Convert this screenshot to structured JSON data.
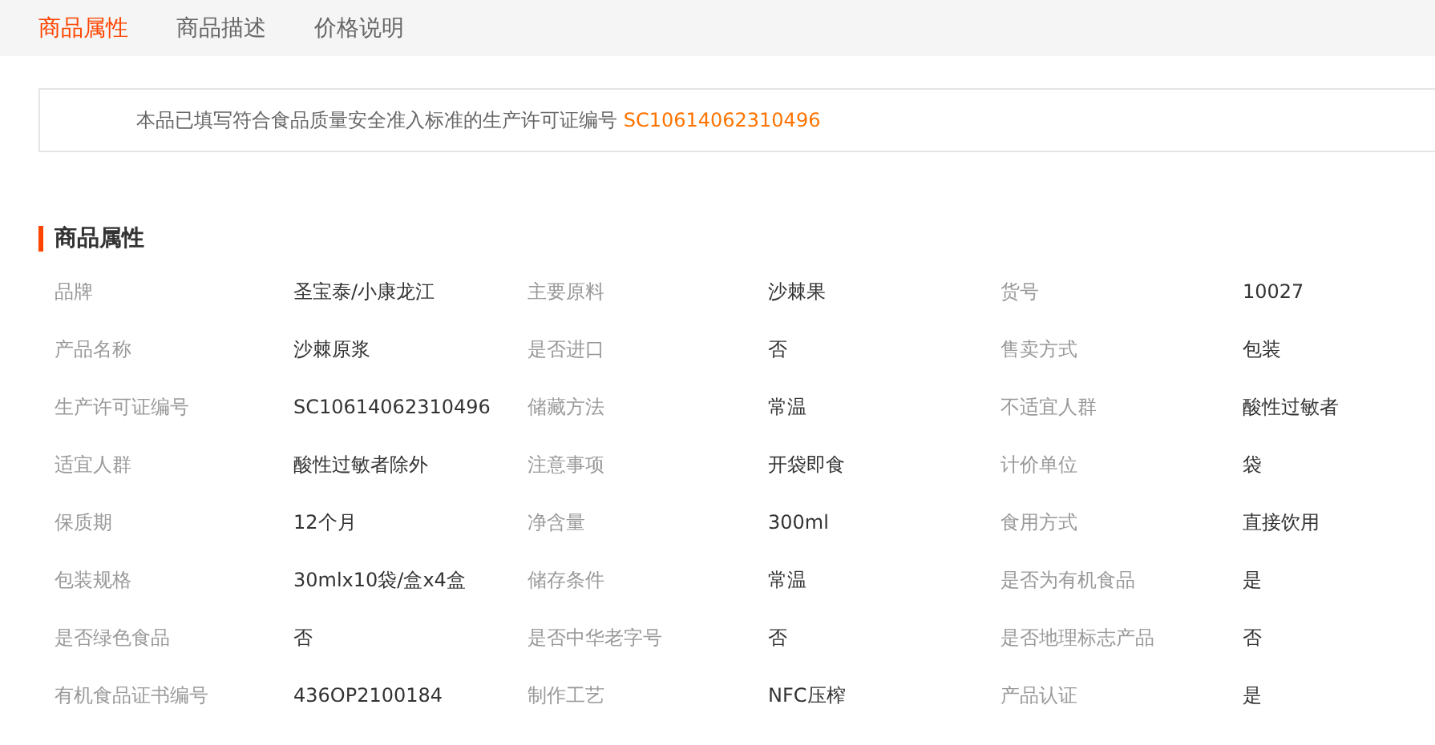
{
  "tabs": [
    {
      "label": "商品属性",
      "selected": true
    },
    {
      "label": "商品描述",
      "selected": false
    },
    {
      "label": "价格说明",
      "selected": false
    }
  ],
  "notice": {
    "text": "本品已填写符合食品质量安全准入标准的生产许可证编号",
    "license": "SC10614062310496"
  },
  "section_title": "商品属性",
  "attributes": [
    {
      "label": "品牌",
      "value": "圣宝泰/小康龙江"
    },
    {
      "label": "主要原料",
      "value": "沙棘果"
    },
    {
      "label": "货号",
      "value": "10027"
    },
    {
      "label": "产品名称",
      "value": "沙棘原浆"
    },
    {
      "label": "是否进口",
      "value": "否"
    },
    {
      "label": "售卖方式",
      "value": "包装"
    },
    {
      "label": "生产许可证编号",
      "value": "SC10614062310496"
    },
    {
      "label": "储藏方法",
      "value": "常温"
    },
    {
      "label": "不适宜人群",
      "value": "酸性过敏者"
    },
    {
      "label": "适宜人群",
      "value": "酸性过敏者除外"
    },
    {
      "label": "注意事项",
      "value": "开袋即食"
    },
    {
      "label": "计价单位",
      "value": "袋"
    },
    {
      "label": "保质期",
      "value": "12个月"
    },
    {
      "label": "净含量",
      "value": "300ml"
    },
    {
      "label": "食用方式",
      "value": "直接饮用"
    },
    {
      "label": "包装规格",
      "value": "30mlx10袋/盒x4盒"
    },
    {
      "label": "储存条件",
      "value": "常温"
    },
    {
      "label": "是否为有机食品",
      "value": "是"
    },
    {
      "label": "是否绿色食品",
      "value": "否"
    },
    {
      "label": "是否中华老字号",
      "value": "否"
    },
    {
      "label": "是否地理标志产品",
      "value": "否"
    },
    {
      "label": "有机食品证书编号",
      "value": "436OP2100184"
    },
    {
      "label": "制作工艺",
      "value": "NFC压榨"
    },
    {
      "label": "产品认证",
      "value": "是"
    }
  ]
}
